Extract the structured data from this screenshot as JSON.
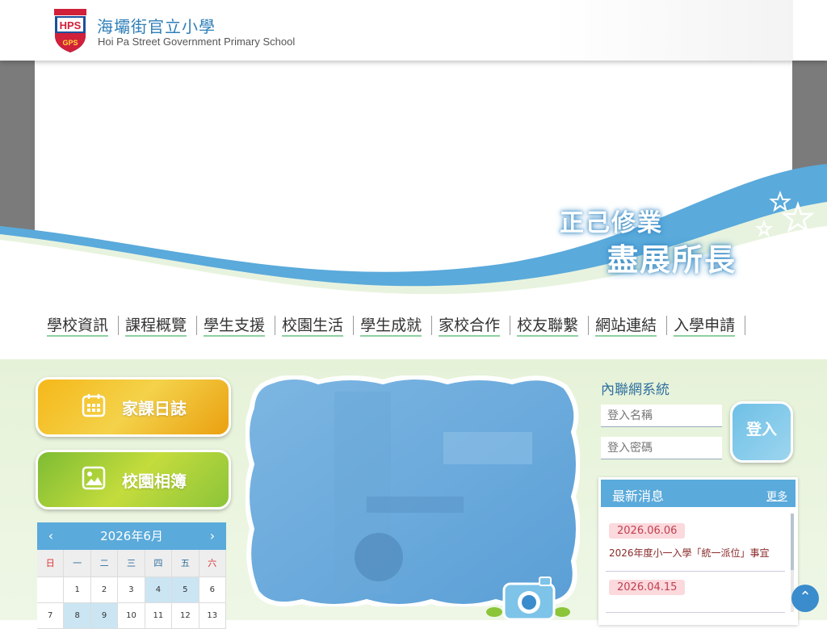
{
  "header": {
    "school_name_cn": "海壩街官立小學",
    "school_name_en": "Hoi Pa Street Government Primary School",
    "logo": {
      "top_text": "HPS",
      "bottom_text": "GPS",
      "icon": "school-crest-icon"
    }
  },
  "banner": {
    "slogan_line1": "正己修業",
    "slogan_line2": "盡展所長",
    "icons": [
      "star-icon"
    ]
  },
  "nav": {
    "items": [
      "學校資訊",
      "課程概覽",
      "學生支援",
      "校園生活",
      "學生成就",
      "家校合作",
      "校友聯繫",
      "網站連結",
      "入學申請"
    ]
  },
  "quick_links": {
    "homework": {
      "label": "家課日誌",
      "icon": "calendar-icon"
    },
    "album": {
      "label": "校園相簿",
      "icon": "image-icon"
    }
  },
  "calendar": {
    "title": "2026年6月",
    "prev": "‹",
    "next": "›",
    "weekdays": [
      "日",
      "一",
      "二",
      "三",
      "四",
      "五",
      "六"
    ],
    "rows": [
      [
        "",
        "1",
        "2",
        "3",
        "4",
        "5",
        "6"
      ],
      [
        "7",
        "8",
        "9",
        "10",
        "11",
        "12",
        "13"
      ]
    ],
    "highlighted": [
      "4",
      "5",
      "8",
      "9"
    ]
  },
  "intranet": {
    "title": "內聯網系統",
    "username_placeholder": "登入名稱",
    "password_placeholder": "登入密碼",
    "login_label": "登入"
  },
  "news": {
    "title": "最新消息",
    "more": "更多",
    "items": [
      {
        "date": "2026.06.06",
        "text": "2026年度小一入學「統一派位」事宜"
      },
      {
        "date": "2026.04.15",
        "text": ""
      }
    ]
  },
  "colors": {
    "accent_blue": "#5aaadb",
    "logo_red": "#d0203a",
    "logo_blue": "#1d4f9c",
    "homework_orange": "#f5b81a",
    "album_green": "#8cc43a"
  },
  "back_to_top": "⌃"
}
